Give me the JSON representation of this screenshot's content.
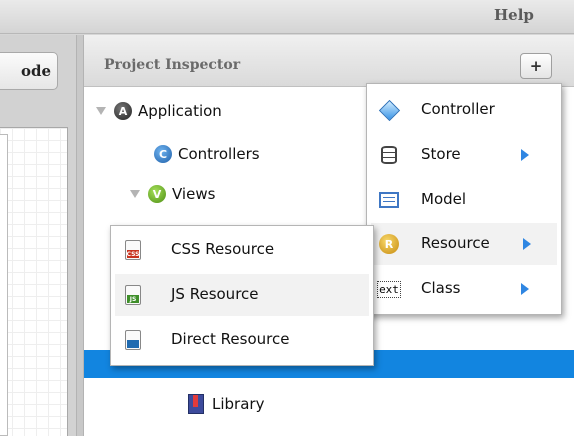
{
  "menubar": {
    "help": "Help"
  },
  "left_panel": {
    "code_tab": "ode"
  },
  "inspector": {
    "title": "Project Inspector",
    "add_label": "+",
    "tree": {
      "application": "Application",
      "controllers": "Controllers",
      "views": "Views",
      "library": "Library"
    }
  },
  "add_menu": {
    "items": [
      {
        "label": "Controller",
        "icon": "controller-icon"
      },
      {
        "label": "Store",
        "icon": "store-icon",
        "submenu": true
      },
      {
        "label": "Model",
        "icon": "model-icon"
      },
      {
        "label": "Resource",
        "icon": "resource-icon",
        "submenu": true,
        "hover": true
      },
      {
        "label": "Class",
        "icon": "class-icon",
        "submenu": true
      }
    ],
    "resource_badge": "R",
    "class_badge": "ext"
  },
  "resource_menu": {
    "items": [
      {
        "label": "CSS Resource",
        "icon": "css-file-icon",
        "tag": "CSS",
        "color": "#c8321e"
      },
      {
        "label": "JS Resource",
        "icon": "js-file-icon",
        "tag": "JS",
        "color": "#3f8f2a",
        "hover": true
      },
      {
        "label": "Direct Resource",
        "icon": "direct-file-icon",
        "tag": "",
        "color": "#1f6ab0"
      }
    ]
  },
  "colors": {
    "selection": "#1285e0",
    "submenu_arrow": "#2f86e2"
  }
}
